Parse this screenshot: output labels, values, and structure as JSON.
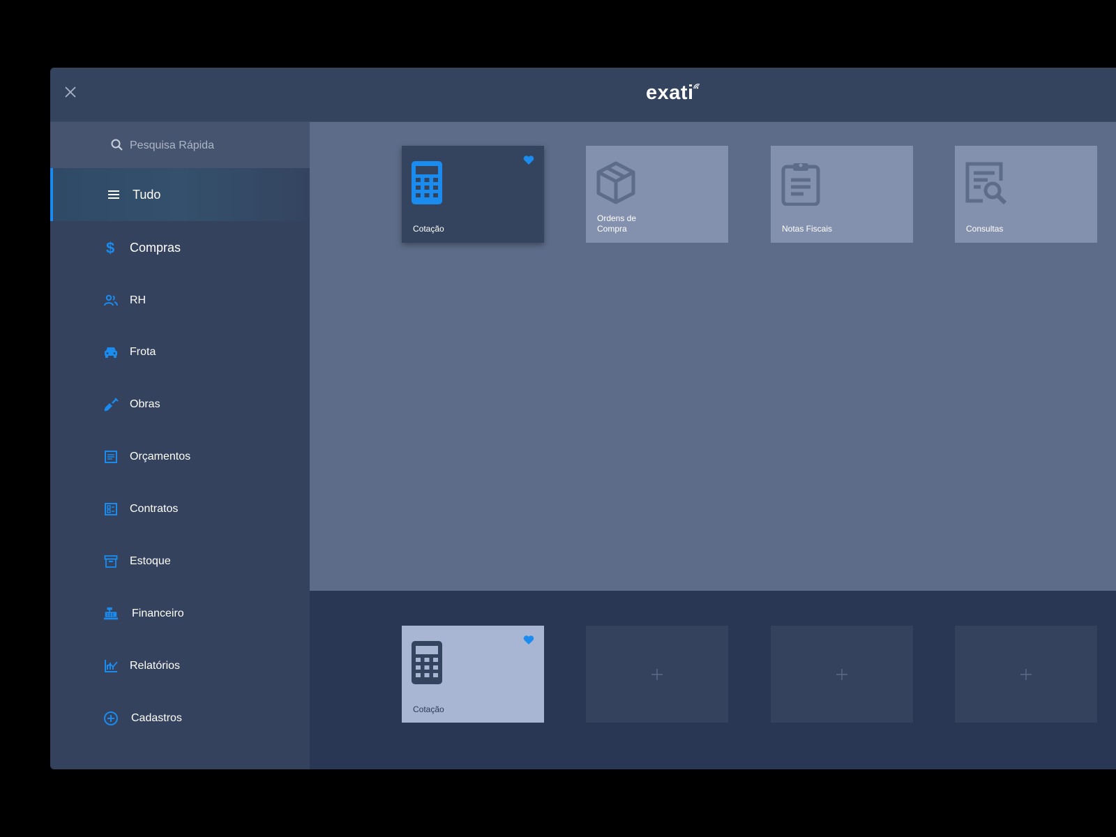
{
  "app": {
    "logo": "exati"
  },
  "search": {
    "placeholder": "Pesquisa Rápida"
  },
  "sidebar": {
    "items": [
      {
        "label": "Tudo",
        "icon": "menu-icon",
        "active": true
      },
      {
        "label": "Compras",
        "icon": "dollar-icon"
      },
      {
        "label": "RH",
        "icon": "people-icon"
      },
      {
        "label": "Frota",
        "icon": "car-icon"
      },
      {
        "label": "Obras",
        "icon": "shovel-icon"
      },
      {
        "label": "Orçamentos",
        "icon": "list-document-icon"
      },
      {
        "label": "Contratos",
        "icon": "contract-icon"
      },
      {
        "label": "Estoque",
        "icon": "archive-box-icon"
      },
      {
        "label": "Financeiro",
        "icon": "cash-register-icon"
      },
      {
        "label": "Relatórios",
        "icon": "chart-icon"
      },
      {
        "label": "Cadastros",
        "icon": "add-circle-icon"
      }
    ]
  },
  "main": {
    "tiles": [
      {
        "label": "Cotação",
        "icon": "calculator-icon",
        "favorite": true,
        "selected": true
      },
      {
        "label_line1": "Ordens de",
        "label_line2": "Compra",
        "icon": "box-icon"
      },
      {
        "label": "Notas Fiscais",
        "icon": "clipboard-icon"
      },
      {
        "label": "Consultas",
        "icon": "document-search-icon"
      }
    ]
  },
  "favorites": {
    "items": [
      {
        "label": "Cotação",
        "icon": "calculator-icon",
        "favorite": true
      }
    ],
    "empty_slot_icon": "plus-icon"
  },
  "colors": {
    "accent": "#1a8cf0",
    "topbar": "#34445f",
    "sidebar": "#34425e",
    "main": "#5d6c89",
    "tray": "#293754"
  }
}
